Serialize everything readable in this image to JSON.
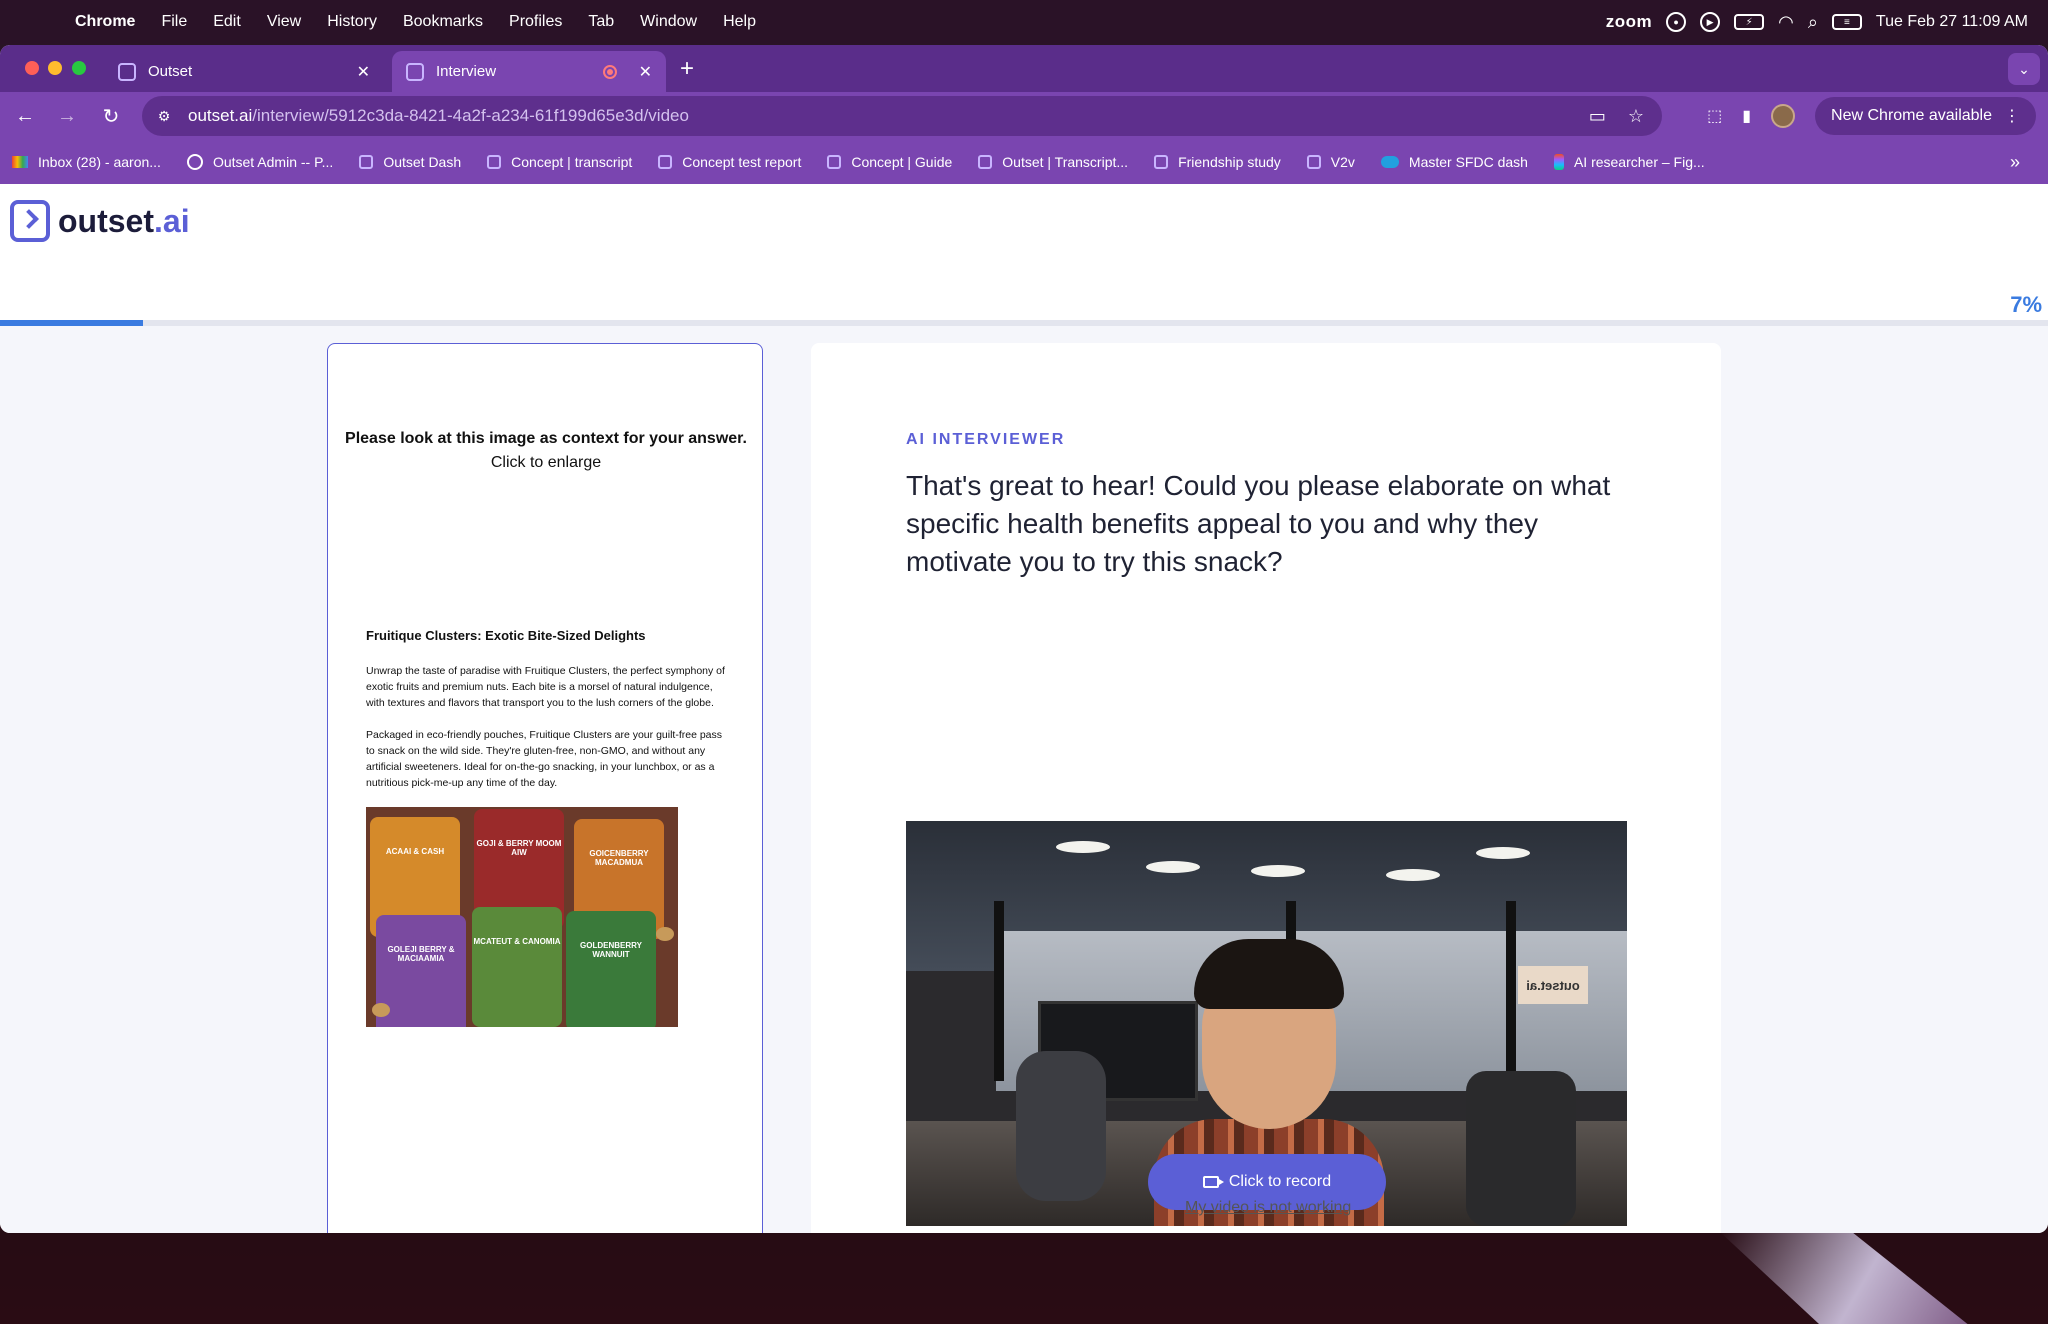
{
  "menubar": {
    "app_name": "Chrome",
    "menus": [
      "File",
      "Edit",
      "View",
      "History",
      "Bookmarks",
      "Profiles",
      "Tab",
      "Window",
      "Help"
    ],
    "zoom_label": "zoom",
    "datetime": "Tue Feb 27  11:09 AM"
  },
  "tabs": [
    {
      "title": "Outset",
      "active": false
    },
    {
      "title": "Interview",
      "active": true
    }
  ],
  "toolbar": {
    "url_host": "outset.ai",
    "url_path": "/interview/5912c3da-8421-4a2f-a234-61f199d65e3d/video",
    "update_label": "New Chrome available"
  },
  "bookmarks": [
    {
      "label": "Inbox (28) - aaron...",
      "icon": "gmail-icon"
    },
    {
      "label": "Outset Admin -- P...",
      "icon": "globe-icon"
    },
    {
      "label": "Outset Dash",
      "icon": "outset-icon"
    },
    {
      "label": "Concept | transcript",
      "icon": "outset-icon"
    },
    {
      "label": "Concept test report",
      "icon": "outset-icon"
    },
    {
      "label": "Concept | Guide",
      "icon": "outset-icon"
    },
    {
      "label": "Outset | Transcript...",
      "icon": "outset-icon"
    },
    {
      "label": "Friendship study",
      "icon": "outset-icon"
    },
    {
      "label": "V2v",
      "icon": "outset-icon"
    },
    {
      "label": "Master SFDC dash",
      "icon": "salesforce-icon"
    },
    {
      "label": "AI researcher – Fig...",
      "icon": "figma-icon"
    }
  ],
  "site": {
    "logo_main": "outset",
    "logo_dot_ai": ".ai",
    "progress_percent": 7,
    "progress_label": "7%"
  },
  "context": {
    "instruction": "Please look at this image as context for your answer.",
    "enlarge_hint": "Click to enlarge",
    "doc_heading": "Fruitique Clusters: Exotic Bite-Sized Delights",
    "doc_paragraph_1": "Unwrap the taste of paradise with Fruitique Clusters, the perfect symphony of exotic fruits and premium nuts. Each bite is a morsel of natural indulgence, with textures and flavors that transport you to the lush corners of the globe.",
    "doc_paragraph_2": "Packaged in eco-friendly pouches, Fruitique Clusters are your guilt-free pass to snack on the wild side. They're gluten-free, non-GMO, and without any artificial sweeteners. Ideal for on-the-go snacking, in your lunchbox, or as a nutritious pick-me-up any time of the day.",
    "pouches": [
      "ACAAI & CASH",
      "GOJI & BERRY MOOM AIW",
      "GOICENBERRY MACADMUA",
      "GOLEJI BERRY & MACIAAMIA",
      "MCATEUT & CANOMIA",
      "GOLDENBERRY WANNUIT"
    ]
  },
  "interview": {
    "label": "AI INTERVIEWER",
    "question": "That's great to hear! Could you please elaborate on what specific health benefits appeal to you and why they motivate you to try this snack?",
    "record_label": "Click to record",
    "help_link": "My video is not working",
    "office_sign": "outset.ai"
  }
}
